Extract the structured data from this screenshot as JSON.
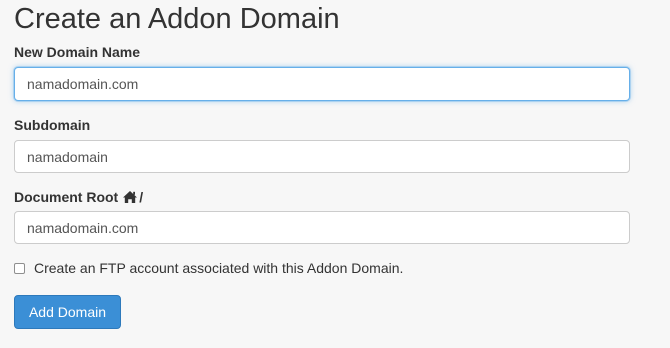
{
  "page": {
    "title": "Create an Addon Domain"
  },
  "form": {
    "new_domain": {
      "label": "New Domain Name",
      "value": "namadomain.com"
    },
    "subdomain": {
      "label": "Subdomain",
      "value": "namadomain"
    },
    "document_root": {
      "label": "Document Root",
      "suffix": "/",
      "icon": "home-icon",
      "value": "namadomain.com"
    },
    "ftp_checkbox": {
      "label": "Create an FTP account associated with this Addon Domain.",
      "checked": false
    },
    "submit_label": "Add Domain"
  },
  "colors": {
    "background": "#f7f7f7",
    "button": "#3b8fd6",
    "focus": "#66afe9"
  }
}
